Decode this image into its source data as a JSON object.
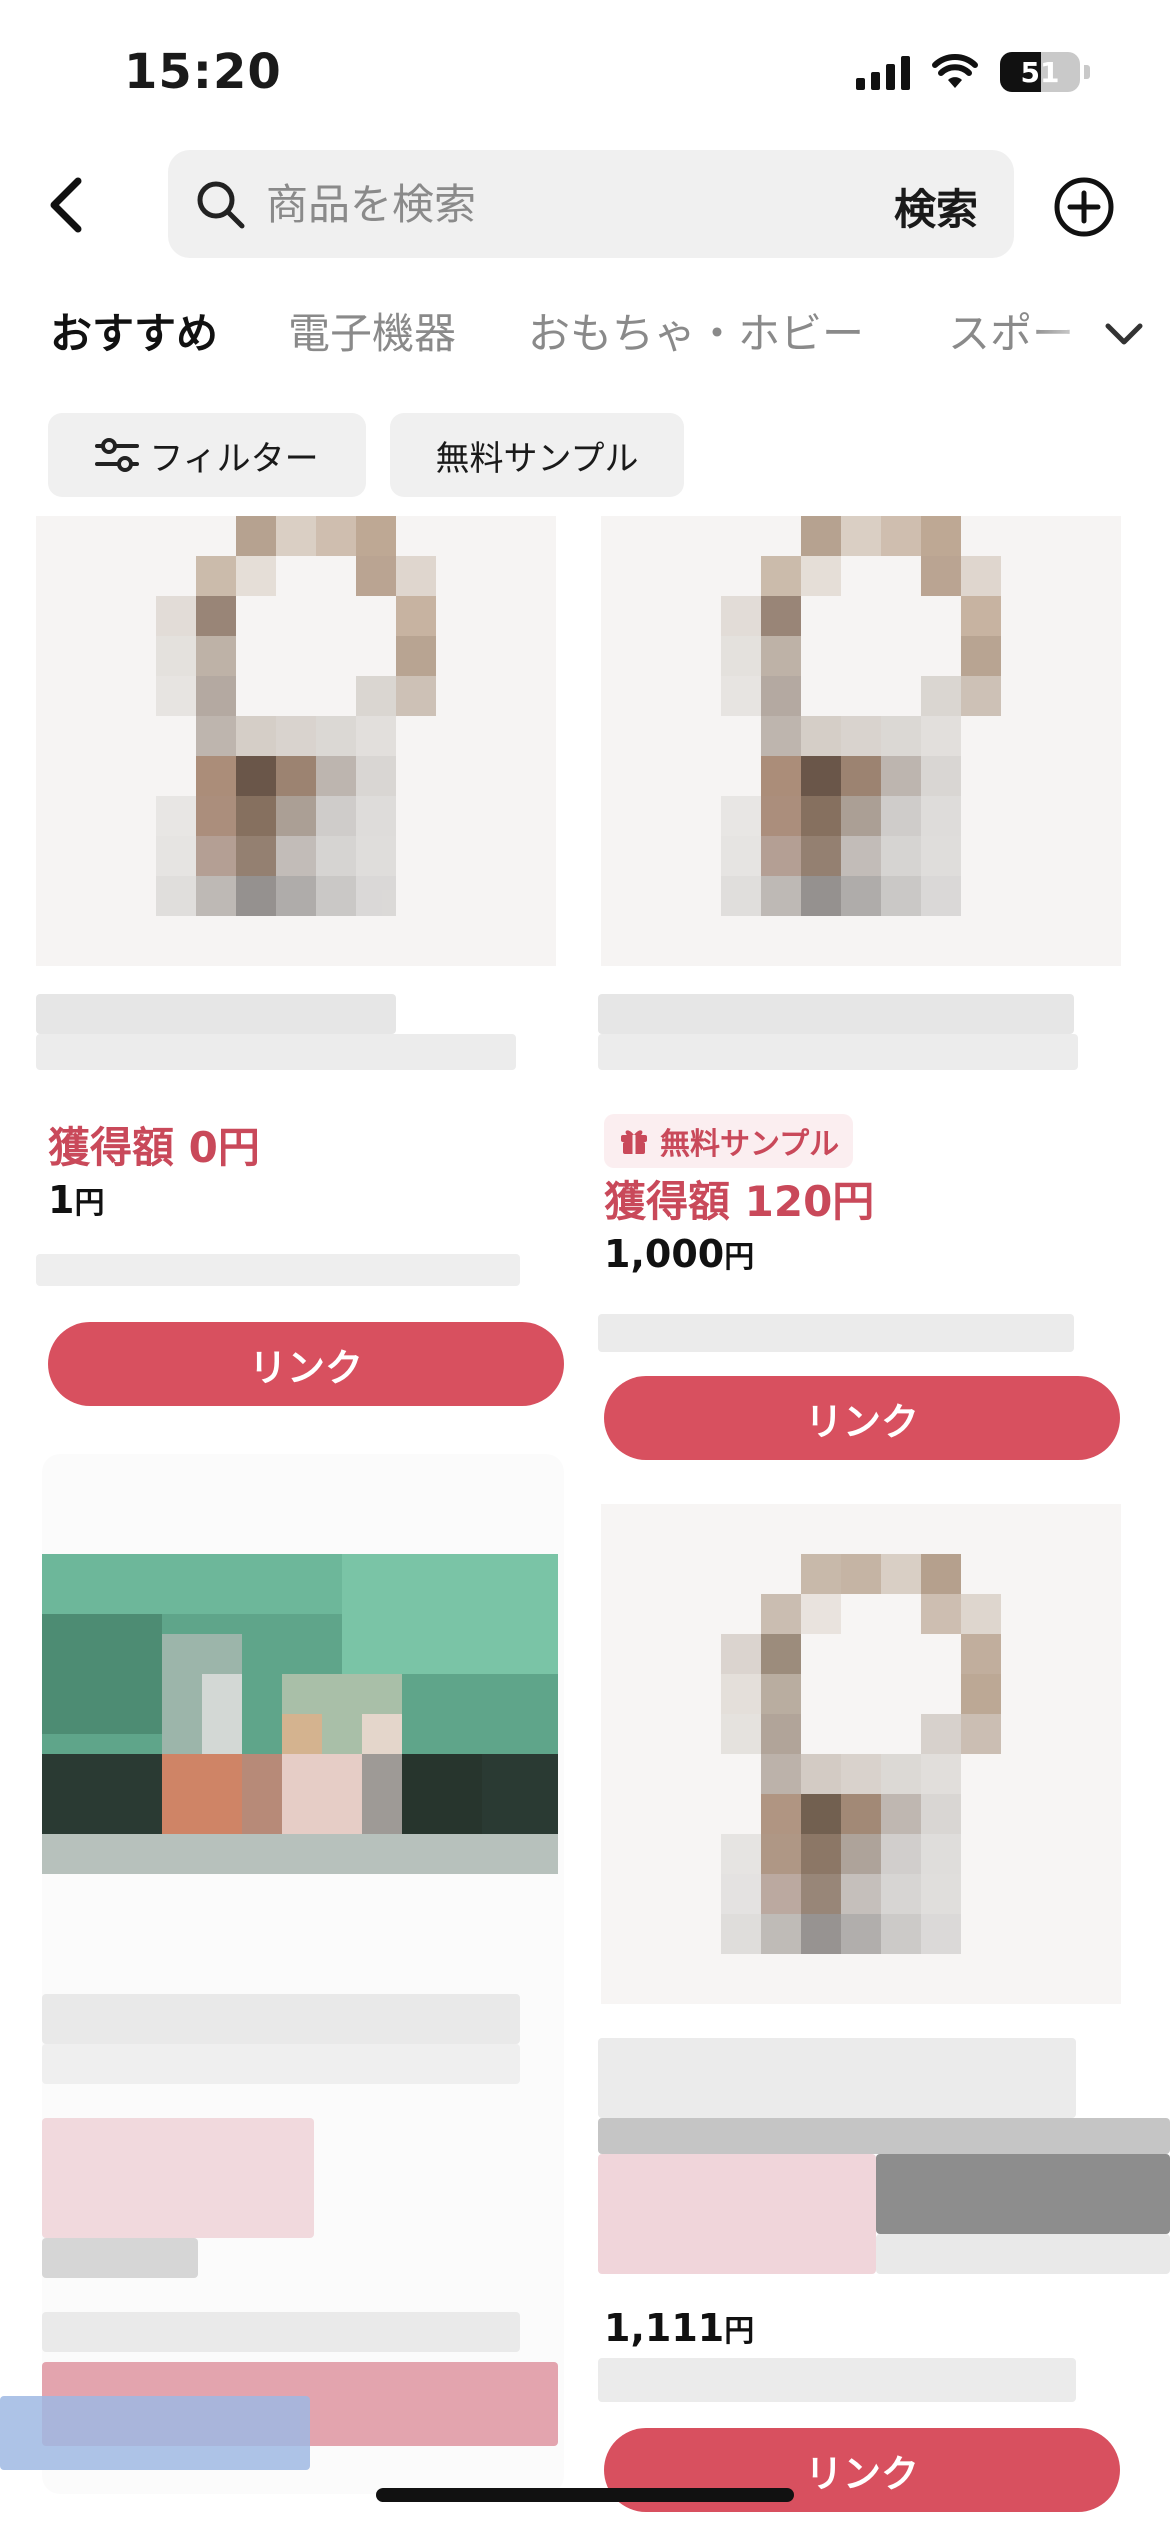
{
  "status_bar": {
    "time": "15:20",
    "battery_level": "51",
    "battery_fraction": 0.51,
    "icons": [
      "cellular-signal-icon",
      "wifi-icon",
      "battery-icon"
    ]
  },
  "header": {
    "back_icon": "chevron-left-icon",
    "search": {
      "placeholder": "商品を検索",
      "value": "",
      "submit_label": "検索"
    },
    "add_icon": "plus-circle-icon"
  },
  "tabs": {
    "items": [
      {
        "label": "おすすめ",
        "active": true
      },
      {
        "label": "電子機器",
        "active": false
      },
      {
        "label": "おもちゃ・ホビー",
        "active": false
      },
      {
        "label": "スポー",
        "active": false
      }
    ],
    "expand_icon": "chevron-down-icon"
  },
  "filters": {
    "filter_label": "フィルター",
    "filter_icon": "sliders-icon",
    "sample_label": "無料サンプル"
  },
  "products": [
    {
      "earn": "獲得額 0円",
      "price": "1",
      "currency": "円",
      "sample_badge": "",
      "link_label": "リンク"
    },
    {
      "earn": "獲得額 120円",
      "price": "1,000",
      "currency": "円",
      "sample_badge": "無料サンプル",
      "link_label": "リンク"
    },
    {
      "earn": "",
      "price": "",
      "currency": "",
      "sample_badge": "",
      "link_label": ""
    },
    {
      "earn": "",
      "price": "1,111",
      "currency": "円",
      "sample_badge": "",
      "link_label": "リンク"
    }
  ],
  "colors": {
    "accent": "#d8505f",
    "earn_text": "#c9495a",
    "chip_bg": "#f0f0f0",
    "badge_bg": "#fbeef0"
  }
}
